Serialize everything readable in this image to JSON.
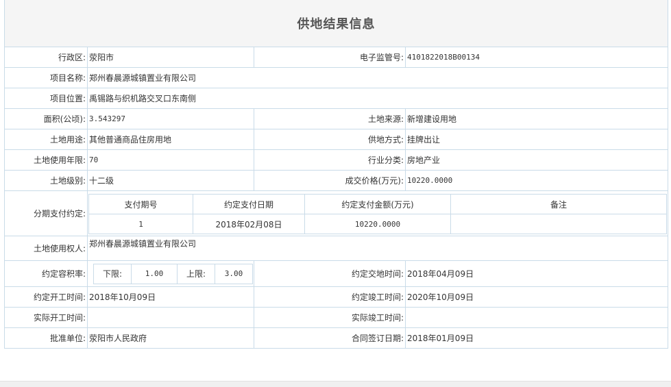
{
  "title": "供地结果信息",
  "fields": {
    "district": {
      "label": "行政区:",
      "value": "荥阳市"
    },
    "supervision_no": {
      "label": "电子监管号:",
      "value": "4101822018B00134"
    },
    "project_name": {
      "label": "项目名称:",
      "value": "郑州春晨源城镇置业有限公司"
    },
    "project_location": {
      "label": "项目位置:",
      "value": "禹锡路与织机路交叉口东南侧"
    },
    "area": {
      "label": "面积(公顷):",
      "value": "3.543297"
    },
    "land_source": {
      "label": "土地来源:",
      "value": "新增建设用地"
    },
    "land_use": {
      "label": "土地用途:",
      "value": "其他普通商品住房用地"
    },
    "supply_method": {
      "label": "供地方式:",
      "value": "挂牌出让"
    },
    "use_years": {
      "label": "土地使用年限:",
      "value": "70"
    },
    "industry": {
      "label": "行业分类:",
      "value": "房地产业"
    },
    "land_grade": {
      "label": "土地级别:",
      "value": "十二级"
    },
    "deal_price": {
      "label": "成交价格(万元):",
      "value": "10220.0000"
    },
    "installment": {
      "label": "分期支付约定:",
      "headers": [
        "支付期号",
        "约定支付日期",
        "约定支付金额(万元)",
        "备注"
      ],
      "rows": [
        [
          "1",
          "2018年02月08日",
          "10220.0000",
          ""
        ]
      ]
    },
    "land_user": {
      "label": "土地使用权人:",
      "value": "郑州春晨源城镇置业有限公司"
    },
    "plot_ratio": {
      "label": "约定容积率:",
      "lower_label": "下限:",
      "lower": "1.00",
      "upper_label": "上限:",
      "upper": "3.00"
    },
    "delivery_time": {
      "label": "约定交地时间:",
      "value": "2018年04月09日"
    },
    "start_time": {
      "label": "约定开工时间:",
      "value": "2018年10月09日"
    },
    "finish_time": {
      "label": "约定竣工时间:",
      "value": "2020年10月09日"
    },
    "actual_start": {
      "label": "实际开工时间:",
      "value": ""
    },
    "actual_finish": {
      "label": "实际竣工时间:",
      "value": ""
    },
    "approval_unit": {
      "label": "批准单位:",
      "value": "荥阳市人民政府"
    },
    "contract_date": {
      "label": "合同签订日期:",
      "value": "2018年01月09日"
    }
  }
}
